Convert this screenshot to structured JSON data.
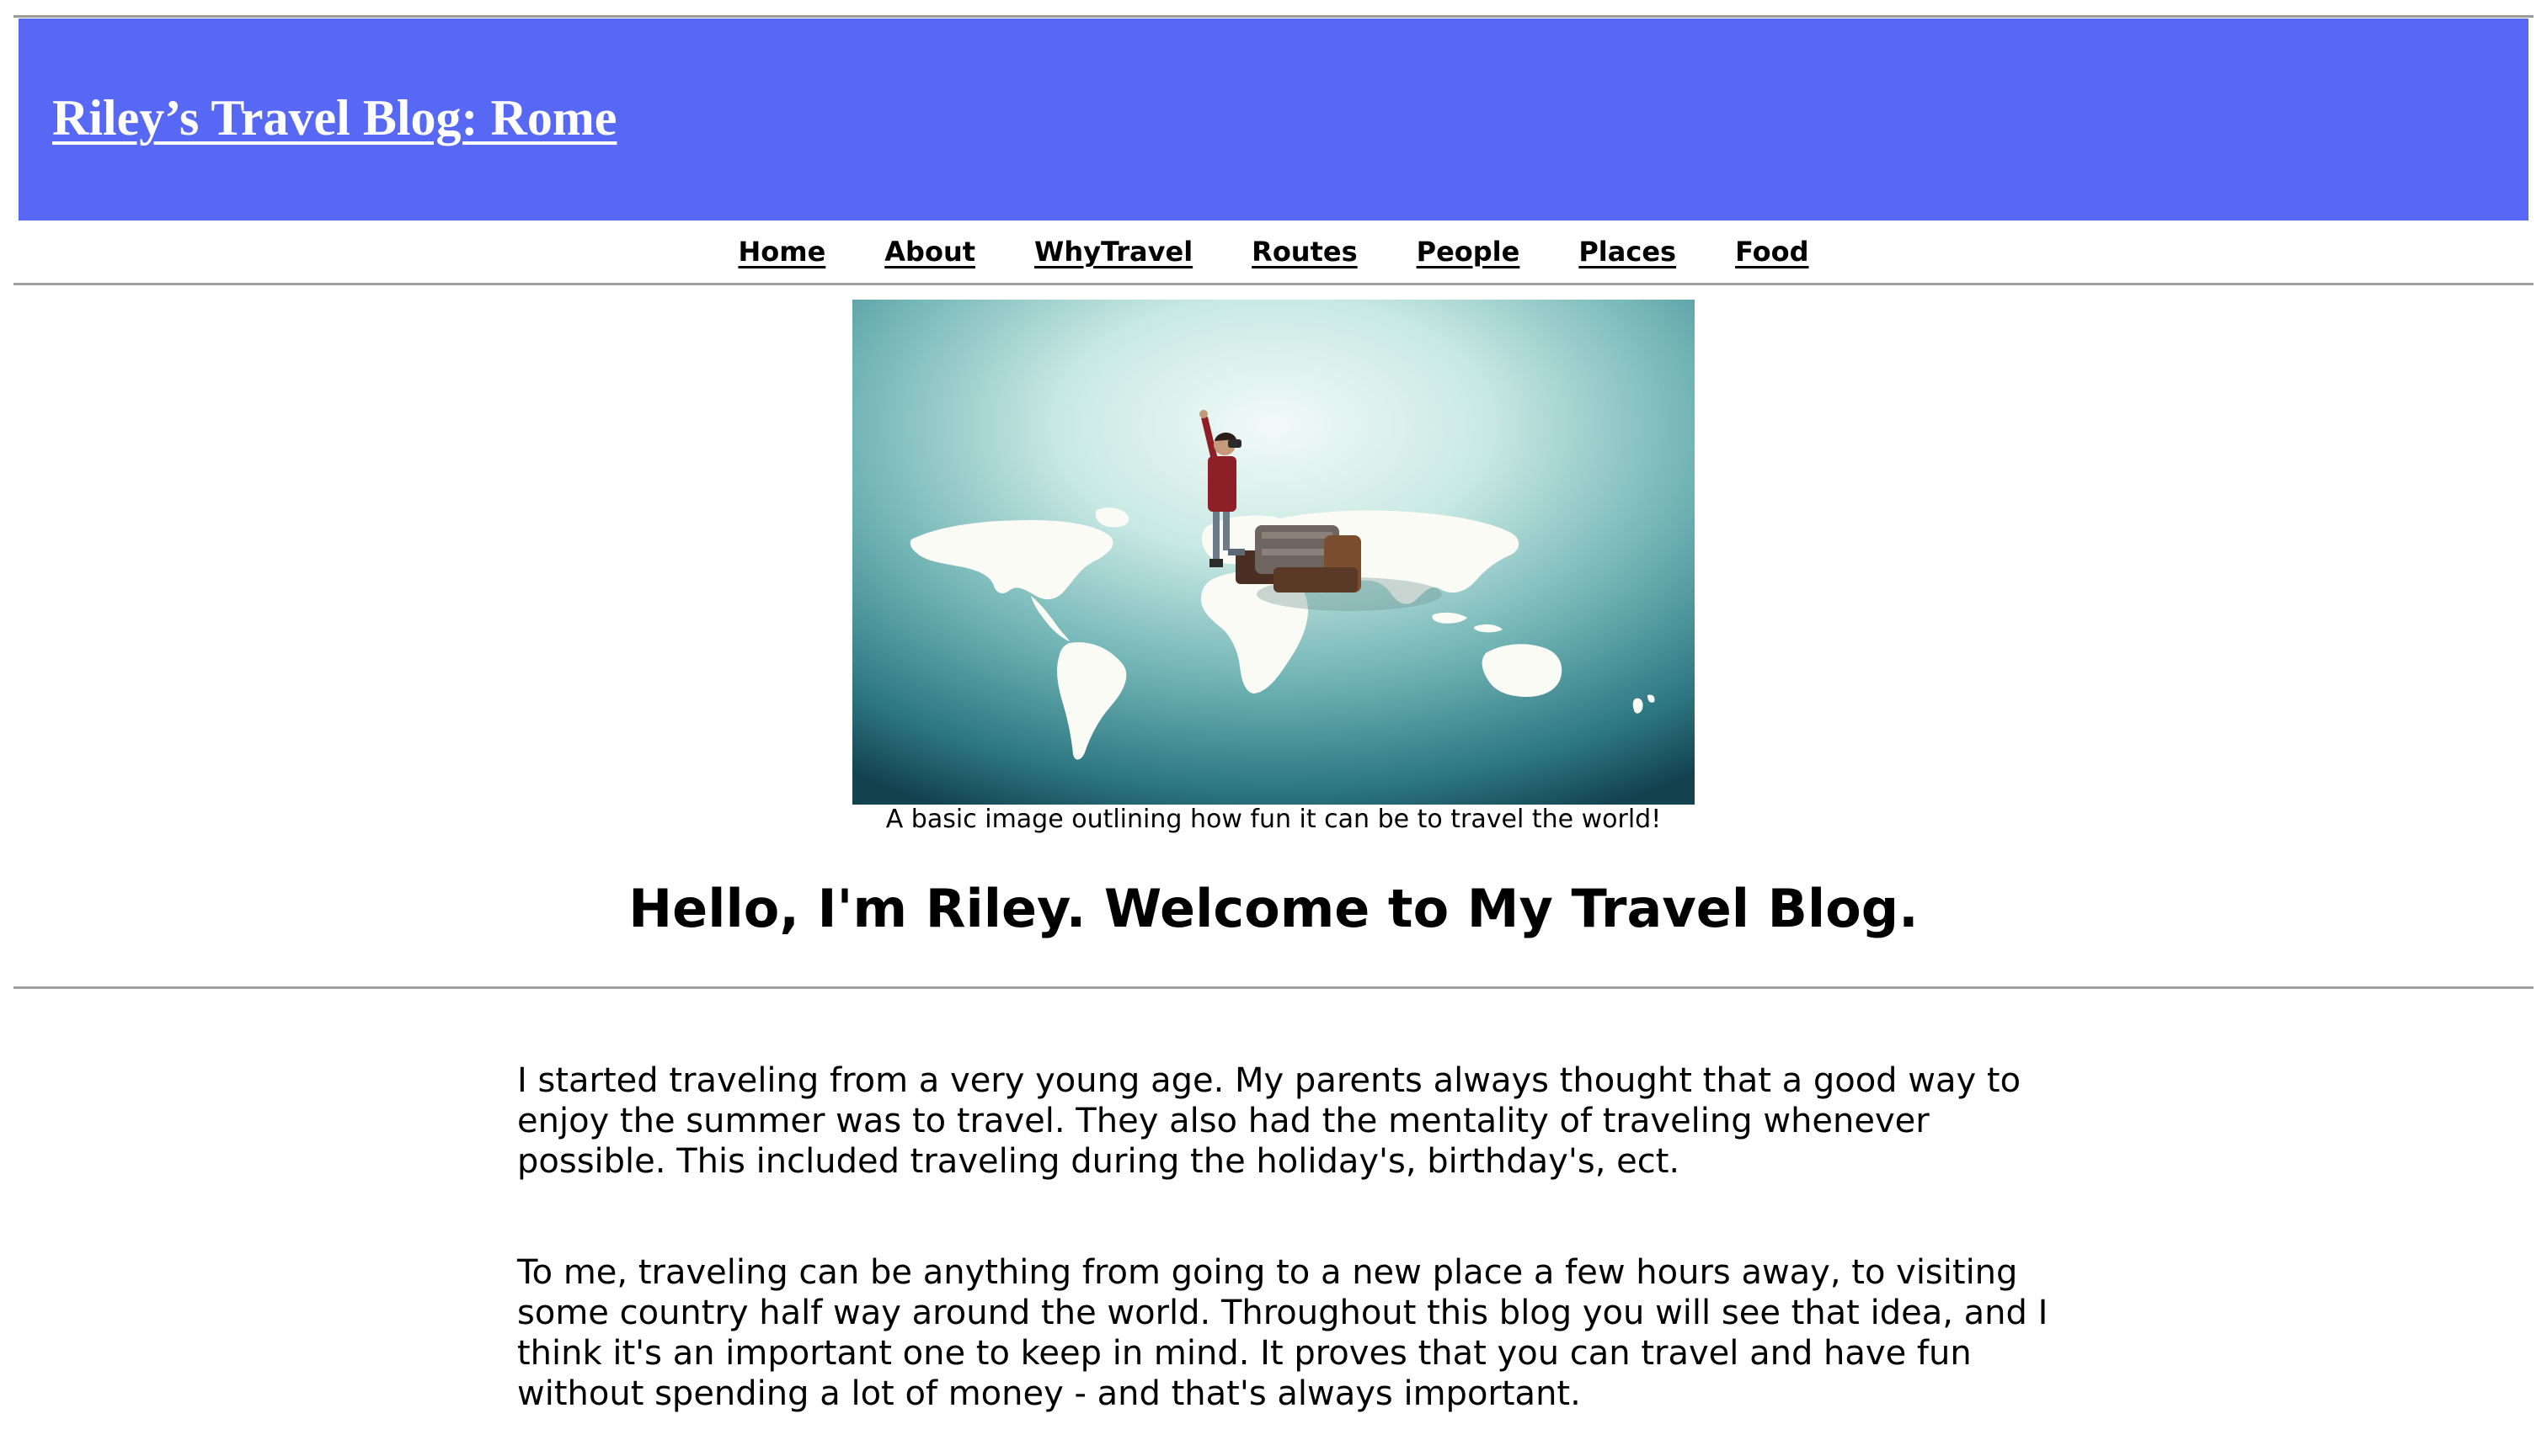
{
  "banner": {
    "title": "Riley’s Travel Blog: Rome",
    "background_color": "#5769f4",
    "title_color": "#ffffff"
  },
  "nav": {
    "items": [
      {
        "label": "Home"
      },
      {
        "label": "About"
      },
      {
        "label": "WhyTravel"
      },
      {
        "label": "Routes"
      },
      {
        "label": "People"
      },
      {
        "label": "Places"
      },
      {
        "label": "Food"
      }
    ]
  },
  "hero": {
    "caption": "A basic image outlining how fun it can be to travel the world!"
  },
  "main": {
    "heading": "Hello, I'm Riley. Welcome to My Travel Blog.",
    "paragraphs": [
      "I started traveling from a very young age. My parents always thought that a good way to enjoy the summer was to travel. They also had the mentality of traveling whenever possible. This included traveling during the holiday's, birthday's, ect.",
      "To me, traveling can be anything from going to a new place a few hours away, to visiting some country half way around the world. Throughout this blog you will see that idea, and I think it's an important one to keep in mind. It proves that you can travel and have fun without spending a lot of money - and that's always important."
    ]
  }
}
